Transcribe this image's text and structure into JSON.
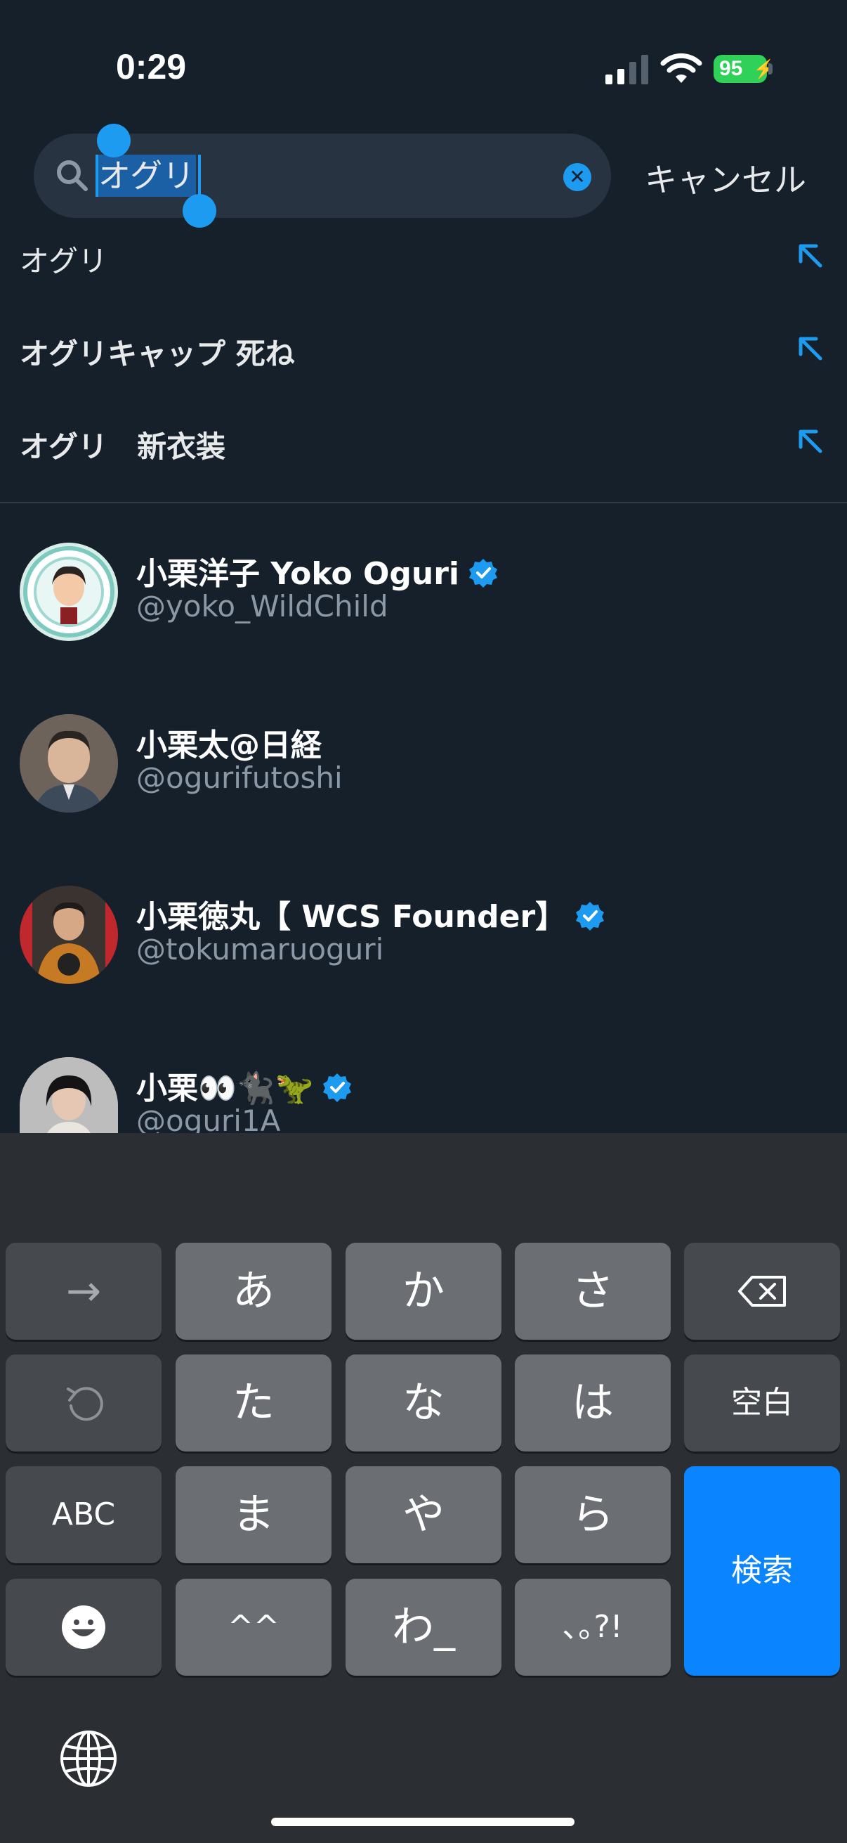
{
  "status_bar": {
    "time": "0:29",
    "battery": "95"
  },
  "search": {
    "query": "オグリ",
    "cancel_label": "キャンセル"
  },
  "suggestions": [
    {
      "label": "オグリ"
    },
    {
      "label": "オグリキャップ 死ね"
    },
    {
      "label": "オグリ　新衣装"
    }
  ],
  "users": [
    {
      "name": "小栗洋子 Yoko Oguri",
      "handle": "@yoko_WildChild",
      "verified": true
    },
    {
      "name": "小栗太@日経",
      "handle": "@ogurifutoshi",
      "verified": false
    },
    {
      "name": "小栗徳丸【 WCS  Founder】",
      "handle": "@tokumaruoguri",
      "verified": true
    },
    {
      "name": "小栗👀🐈‍⬛🦖",
      "handle": "@oguri1A",
      "verified": true
    }
  ],
  "keyboard": {
    "row1": [
      "→",
      "あ",
      "か",
      "さ"
    ],
    "row2": [
      "た",
      "な",
      "は",
      "空白"
    ],
    "row3": [
      "ABC",
      "ま",
      "や",
      "ら"
    ],
    "row4": [
      "^^",
      "わ_",
      "､｡?!"
    ],
    "search_key": "検索"
  },
  "colors": {
    "accent": "#1d9bf0",
    "background": "#15202b",
    "keyboard_blue": "#0a84ff"
  }
}
